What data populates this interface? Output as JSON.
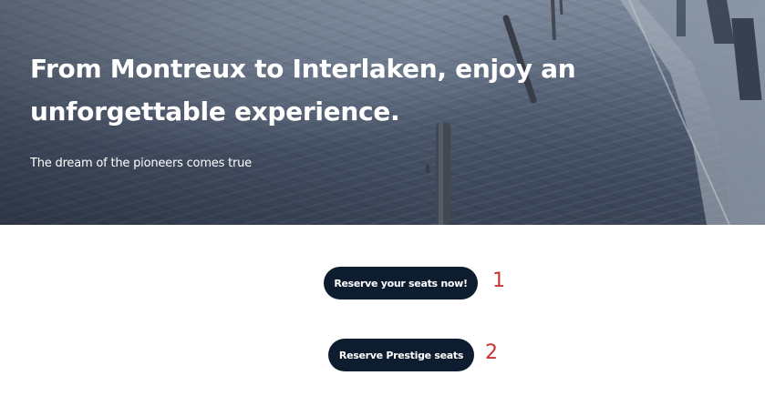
{
  "hero": {
    "title": "From Montreux to Interlaken, enjoy an unforgettable experience.",
    "subtitle": "The dream of the pioneers comes true",
    "background_image": "snowy-railway-train-photo"
  },
  "actions": {
    "primary_label": "Reserve your seats now!",
    "secondary_label": "Reserve Prestige seats"
  },
  "annotations": {
    "marker_1": "1",
    "marker_2": "2",
    "marker_color": "#c7332f"
  },
  "colors": {
    "button_background": "#0d1c2e",
    "button_text": "#ffffff",
    "hero_text": "#ffffff"
  }
}
